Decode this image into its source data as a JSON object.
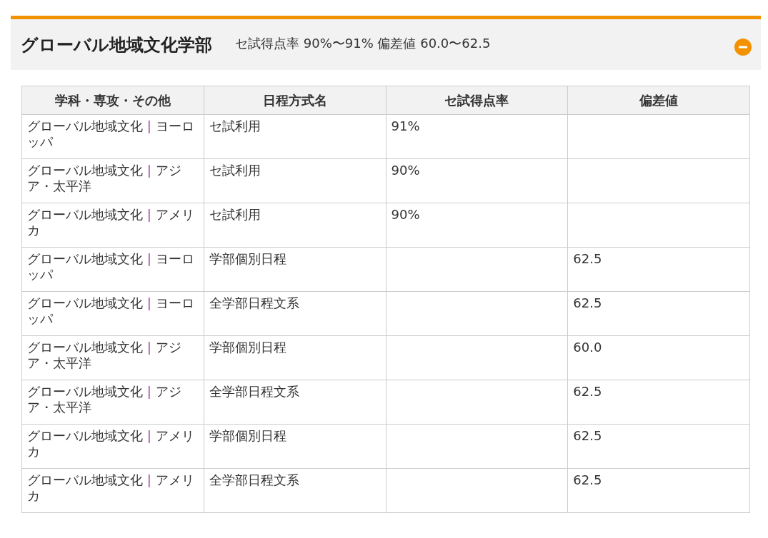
{
  "section": {
    "title": "グローバル地域文化学部",
    "summary": "セ試得点率 90%〜91% 偏差値 60.0〜62.5",
    "expanded": true
  },
  "table": {
    "columns": [
      "学科・専攻・その他",
      "日程方式名",
      "セ試得点率",
      "偏差値"
    ],
    "rows": [
      {
        "department": "グローバル地域文化",
        "separator": "|",
        "major": "ヨーロッパ",
        "schedule": "セ試利用",
        "score_rate": "91%"
      },
      {
        "department": "グローバル地域文化",
        "separator": "|",
        "major": "アジア・太平洋",
        "schedule": "セ試利用",
        "score_rate": "90%"
      },
      {
        "department": "グローバル地域文化",
        "separator": "|",
        "major": "アメリカ",
        "schedule": "セ試利用",
        "score_rate": "90%"
      },
      {
        "department": "グローバル地域文化",
        "separator": "|",
        "major": "ヨーロッパ",
        "schedule": "学部個別日程",
        "deviation": "62.5"
      },
      {
        "department": "グローバル地域文化",
        "separator": "|",
        "major": "ヨーロッパ",
        "schedule": "全学部日程文系",
        "deviation": "62.5"
      },
      {
        "department": "グローバル地域文化",
        "separator": "|",
        "major": "アジア・太平洋",
        "schedule": "学部個別日程",
        "deviation": "60.0"
      },
      {
        "department": "グローバル地域文化",
        "separator": "|",
        "major": "アジア・太平洋",
        "schedule": "全学部日程文系",
        "deviation": "62.5"
      },
      {
        "department": "グローバル地域文化",
        "separator": "|",
        "major": "アメリカ",
        "schedule": "学部個別日程",
        "deviation": "62.5"
      },
      {
        "department": "グローバル地域文化",
        "separator": "|",
        "major": "アメリカ",
        "schedule": "全学部日程文系",
        "deviation": "62.5"
      }
    ]
  }
}
